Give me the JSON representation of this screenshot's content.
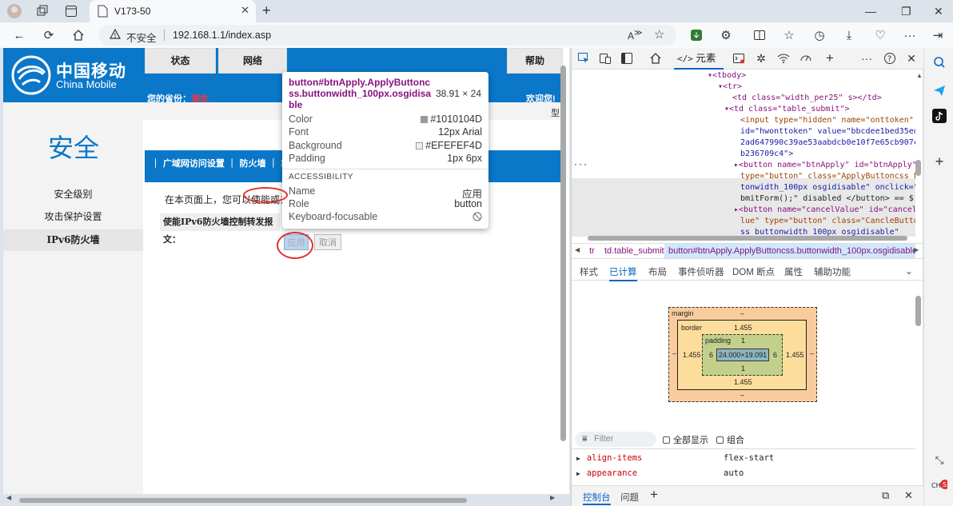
{
  "browser": {
    "tab_title": "V173-50",
    "security_label": "不安全",
    "url": "192.168.1.1/index.asp"
  },
  "page": {
    "logo_cn": "中国移动",
    "logo_en": "China Mobile",
    "province_label": "您的省份：",
    "province_value": "湖北",
    "welcome": "欢迎您!",
    "model_text": "型",
    "section_title": "安全",
    "left_nav": [
      "安全级别",
      "攻击保护设置",
      "IPv6防火墙"
    ],
    "top_nav": [
      "状态",
      "网络",
      "帮助"
    ],
    "sub_nav": "｜ 广域网访问设置 ｜ 防火墙 ｜ MAC",
    "intro": "在本页面上，您可以使能或去使",
    "row_label": "使能IPv6防火墙控制转发报文：",
    "apply_label": "应用",
    "cancel_label": "取消"
  },
  "tooltip": {
    "selector": "button#btnApply.ApplyButtoncss.buttonwidth_100px.osgidisable",
    "size": "38.91 × 24",
    "rows": [
      {
        "k": "Color",
        "v": "#1010104D",
        "swatch": "#1010104D"
      },
      {
        "k": "Font",
        "v": "12px Arial"
      },
      {
        "k": "Background",
        "v": "#EFEFEF4D",
        "swatch": "#EFEFEF4D"
      },
      {
        "k": "Padding",
        "v": "1px 6px"
      }
    ],
    "acc_title": "ACCESSIBILITY",
    "acc_rows": [
      {
        "k": "Name",
        "v": "应用"
      },
      {
        "k": "Role",
        "v": "button"
      },
      {
        "k": "Keyboard-focusable",
        "v": ""
      }
    ]
  },
  "devtools": {
    "tab_elements": "元素",
    "dom_lines": [
      "▾<tbody>",
      "▾<tr>",
      "<td class=\"width_per25\" s></td>",
      "▾<td class=\"table_submit\">",
      "<input type=\"hidden\" name=\"onttoken\"",
      "id=\"hwonttoken\" value=\"bbcdee1bed35ed8",
      "2ad647990c39ae53aabdcb0e10f7e65cb907cd",
      "b236709c4\">",
      "▸<button name=\"btnApply\" id=\"btnApply\"",
      "type=\"button\" class=\"ApplyButtoncss bu",
      "tonwidth_100px osgidisable\" onclick=\"Su",
      "bmitForm();\" disabled  </button> == $",
      "▸<button name=\"cancelValue\" id=\"cancelV",
      "lue\" type=\"button\" class=\"CancleButton",
      "ss buttonwidth 100px osgidisable\""
    ],
    "breadcrumbs": [
      "tr",
      "td.table_submit",
      "button#btnApply.ApplyButtoncss.buttonwidth_100px.osgidisable"
    ],
    "subtabs": [
      "样式",
      "已计算",
      "布局",
      "事件侦听器",
      "DOM 断点",
      "属性",
      "辅助功能"
    ],
    "active_subtab": "已计算",
    "boxmodel": {
      "margin_label": "margin",
      "margin_top": "–",
      "margin_bottom": "–",
      "margin_left": "–",
      "margin_right": "–",
      "border_label": "border",
      "border_top": "1.455",
      "border_bottom": "1.455",
      "border_left": "1.455",
      "border_right": "1.455",
      "padding_label": "padding",
      "padding_top": "1",
      "padding_bottom": "1",
      "padding_left": "6",
      "padding_right": "6",
      "content": "24.000×19.091"
    },
    "filter_placeholder": "Filter",
    "show_all": "全部显示",
    "group": "组合",
    "props": [
      {
        "name": "align-items",
        "value": "flex-start"
      },
      {
        "name": "appearance",
        "value": "auto"
      }
    ],
    "console_tabs": [
      "控制台",
      "问题"
    ]
  },
  "colors": {
    "brand_blue": "#0a77c9",
    "margin_bg": "#f9cc9d",
    "border_bg": "#fddd9b",
    "padding_bg": "#c3d08b",
    "content_bg": "#8cb6c0"
  }
}
